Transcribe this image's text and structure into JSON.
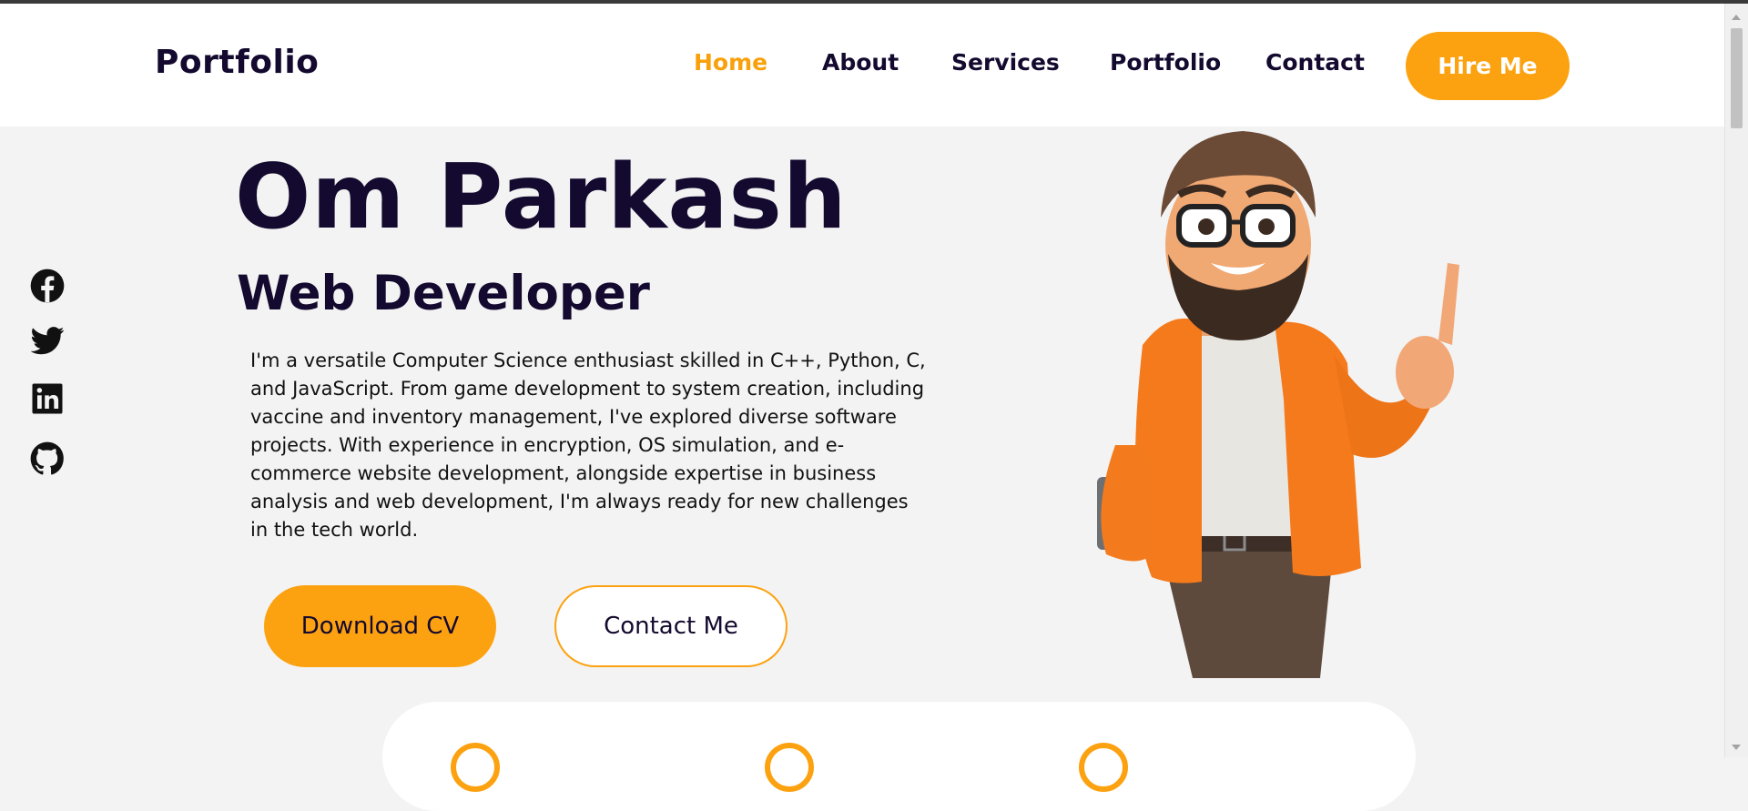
{
  "header": {
    "logo": "Portfolio",
    "nav": [
      {
        "label": "Home",
        "active": true
      },
      {
        "label": "About",
        "active": false
      },
      {
        "label": "Services",
        "active": false
      },
      {
        "label": "Portfolio",
        "active": false
      },
      {
        "label": "Contact",
        "active": false
      }
    ],
    "hire_label": "Hire Me"
  },
  "socials": [
    "facebook-icon",
    "twitter-icon",
    "linkedin-icon",
    "github-icon"
  ],
  "hero": {
    "name": "Om Parkash",
    "role": "Web Developer",
    "bio": "I'm a versatile Computer Science enthusiast skilled in C++, Python, C, and JavaScript. From game development to system creation, including vaccine and inventory management, I've explored diverse software projects. With experience in encryption, OS simulation, and e-commerce website development, alongside expertise in business analysis and web development, I'm always ready for new challenges in the tech world.",
    "download_label": "Download CV",
    "contact_label": "Contact Me"
  },
  "colors": {
    "accent": "#fca211",
    "active_nav": "#f8a10b",
    "text_dark": "#14092e",
    "page_bg": "#f3f3f3"
  }
}
